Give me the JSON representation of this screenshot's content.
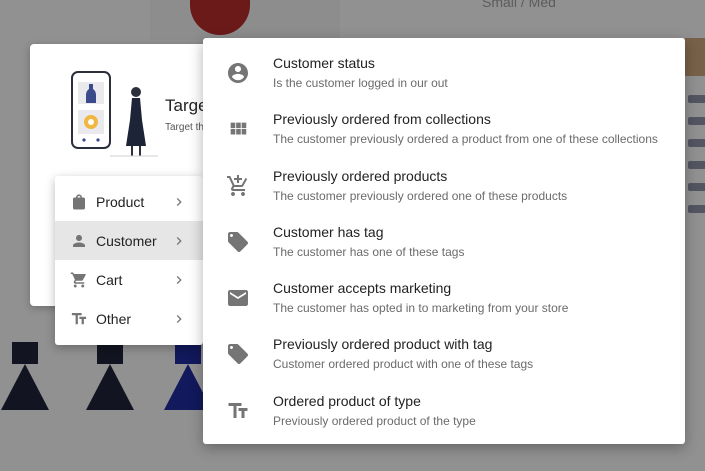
{
  "background": {
    "size_text": "Small / Med",
    "modal_title": "Targe",
    "modal_subtitle": "Target th"
  },
  "category_menu": {
    "items": [
      {
        "label": "Product",
        "icon": "shopping-bag-icon",
        "active": false
      },
      {
        "label": "Customer",
        "icon": "person-icon",
        "active": true
      },
      {
        "label": "Cart",
        "icon": "cart-icon",
        "active": false
      },
      {
        "label": "Other",
        "icon": "text-format-icon",
        "active": false
      }
    ]
  },
  "condition_menu": {
    "items": [
      {
        "title": "Customer status",
        "description": "Is the customer logged in our out",
        "icon": "account-circle-icon"
      },
      {
        "title": "Previously ordered from collections",
        "description": "The customer previously ordered a product from one of these collections",
        "icon": "grid-icon"
      },
      {
        "title": "Previously ordered products",
        "description": "The customer previously ordered one of these products",
        "icon": "add-to-cart-icon"
      },
      {
        "title": "Customer has tag",
        "description": "The customer has one of these tags",
        "icon": "tag-icon"
      },
      {
        "title": "Customer accepts marketing",
        "description": "The customer has opted in to marketing from your store",
        "icon": "mail-icon"
      },
      {
        "title": "Previously ordered product with tag",
        "description": "Customer ordered product with one of these tags",
        "icon": "tag-icon"
      },
      {
        "title": "Ordered product of type",
        "description": "Previously ordered product of the type",
        "icon": "text-format-icon"
      }
    ]
  },
  "colors": {
    "icon": "#757575",
    "active_item_bg": "#e6e6e6",
    "overlay": "rgba(0,0,0,0.40)"
  }
}
